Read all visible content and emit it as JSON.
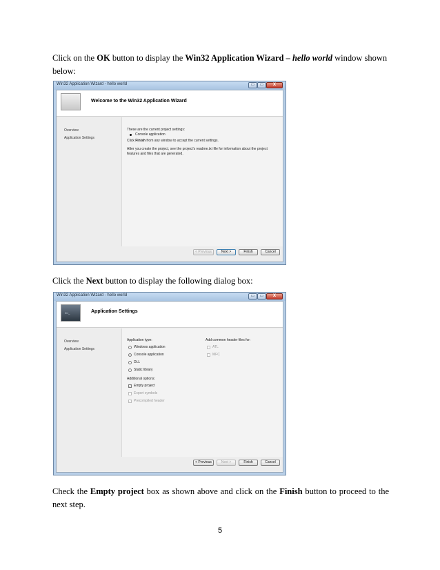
{
  "para1": {
    "a": "Click on the ",
    "b": "OK",
    "c": " button to display the ",
    "d": "Win32 Application Wizard – ",
    "e": "hello world",
    "f": " window shown below:"
  },
  "para2": {
    "a": "Click the ",
    "b": "Next",
    "c": " button to display the following dialog box:"
  },
  "para3": {
    "a": "Check the ",
    "b": "Empty project",
    "c": " box as shown above and click on the ",
    "d": "Finish",
    "e": " button to proceed to the next step."
  },
  "page_number": "5",
  "window": {
    "title": "Win32 Application Wizard - hello world",
    "minimize_glyph": "▭",
    "restore_glyph": "▭",
    "close_glyph": "X"
  },
  "sidebar": {
    "overview": "Overview",
    "app_settings": "Application Settings"
  },
  "dialog1": {
    "heading": "Welcome to the Win32 Application Wizard",
    "line1": "These are the current project settings:",
    "bullet": "Console application",
    "line2a": "Click ",
    "line2b": "Finish",
    "line2c": " from any window to accept the current settings.",
    "line3": "After you create the project, see the project's readme.txt file for information about the project",
    "line4": "features and files that are generated.",
    "buttons": {
      "previous": "< Previous",
      "next": "Next >",
      "finish": "Finish",
      "cancel": "Cancel"
    }
  },
  "dialog2": {
    "heading": "Application Settings",
    "icon_text": "C:\\_",
    "app_type_label": "Application type:",
    "app_types": [
      "Windows application",
      "Console application",
      "DLL",
      "Static library"
    ],
    "additional_label": "Additional options:",
    "options": [
      "Empty project",
      "Export symbols",
      "Precompiled header"
    ],
    "headers_label": "Add common header files for:",
    "headers": [
      "ATL",
      "MFC"
    ],
    "check_glyph": "✓",
    "buttons": {
      "previous": "< Previous",
      "next": "Next >",
      "finish": "Finish",
      "cancel": "Cancel"
    }
  }
}
